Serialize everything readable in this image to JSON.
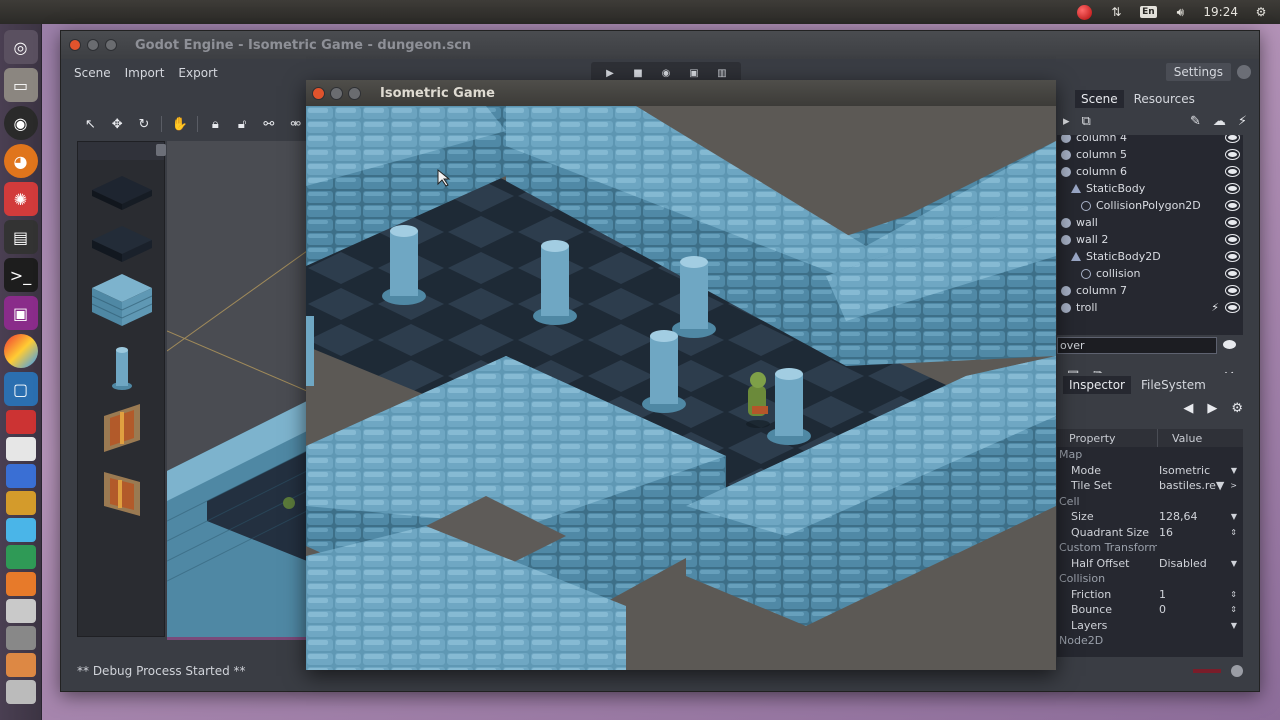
{
  "top_panel": {
    "keyboard_label": "En",
    "time": "19:24"
  },
  "launcher": {
    "items": [
      "dash-icon",
      "files-icon",
      "chromium-icon",
      "firefox-icon",
      "settings-icon",
      "terminal-icon",
      "console-icon",
      "media-icon",
      "color-icon",
      "vm-icon"
    ]
  },
  "editor": {
    "title": "Godot Engine - Isometric Game - dungeon.scn",
    "menu": {
      "scene": "Scene",
      "import": "Import",
      "export": "Export"
    },
    "settings_label": "Settings",
    "debug_text": "** Debug Process Started **"
  },
  "scene_dock": {
    "tabs": [
      "Scene",
      "Resources"
    ],
    "tree": [
      {
        "label": "column 4",
        "kind": "node",
        "indent": 0
      },
      {
        "label": "column 5",
        "kind": "node",
        "indent": 0
      },
      {
        "label": "column 6",
        "kind": "node",
        "indent": 0
      },
      {
        "label": "StaticBody",
        "kind": "body",
        "indent": 1
      },
      {
        "label": "CollisionPolygon2D",
        "kind": "collision",
        "indent": 2
      },
      {
        "label": "wall",
        "kind": "node",
        "indent": 0
      },
      {
        "label": "wall 2",
        "kind": "node",
        "indent": 0
      },
      {
        "label": "StaticBody2D",
        "kind": "body",
        "indent": 1
      },
      {
        "label": "collision",
        "kind": "collision",
        "indent": 2
      },
      {
        "label": "column 7",
        "kind": "node",
        "indent": 0
      },
      {
        "label": "troll",
        "kind": "node",
        "indent": 0
      }
    ],
    "rename_value": "over"
  },
  "inspector": {
    "tabs": [
      "Inspector",
      "FileSystem"
    ],
    "columns": {
      "property": "Property",
      "value": "Value"
    },
    "rows": [
      {
        "name": "Map",
        "value": "",
        "section": true
      },
      {
        "name": "Mode",
        "value": "Isometric",
        "arrow": "▼"
      },
      {
        "name": "Tile Set",
        "value": "bastiles.re▼",
        "arrow": ">"
      },
      {
        "name": "Cell",
        "value": "",
        "section": true
      },
      {
        "name": "Size",
        "value": "128,64",
        "arrow": "▼"
      },
      {
        "name": "Quadrant Size",
        "value": "16",
        "arrow": "⇕"
      },
      {
        "name": "Custom Transform",
        "value": "",
        "section": true
      },
      {
        "name": "Half Offset",
        "value": "Disabled",
        "arrow": "▼"
      },
      {
        "name": "Collision",
        "value": "",
        "section": true
      },
      {
        "name": "Friction",
        "value": "1",
        "arrow": "⇕"
      },
      {
        "name": "Bounce",
        "value": "0",
        "arrow": "⇕"
      },
      {
        "name": "Layers",
        "value": "",
        "arrow": "▼"
      },
      {
        "name": "Node2D",
        "value": "",
        "section": true
      }
    ]
  },
  "game_window": {
    "title": "Isometric Game"
  },
  "colors": {
    "wall_light": "#6fa7c3",
    "wall_dark": "#3d6f88",
    "floor": "#2c3c4c",
    "editor_bg": "#3a3d44"
  }
}
